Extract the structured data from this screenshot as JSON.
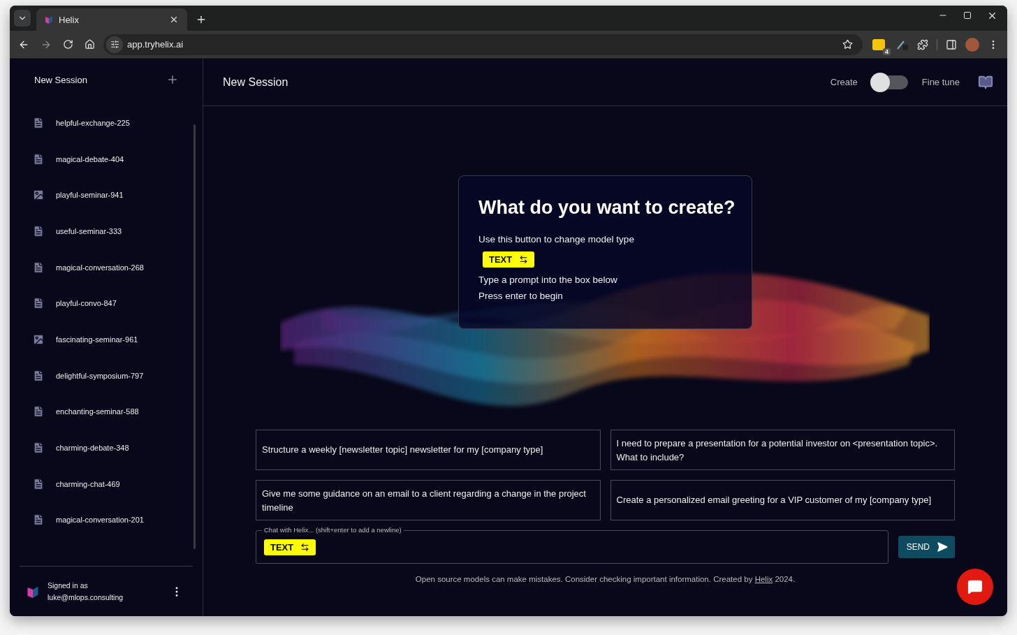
{
  "browser": {
    "tab_title": "Helix",
    "url": "app.tryhelix.ai",
    "extension_badge": "4"
  },
  "sidebar": {
    "title": "New Session",
    "sessions": [
      {
        "name": "helpful-exchange-225",
        "kind": "text"
      },
      {
        "name": "magical-debate-404",
        "kind": "text"
      },
      {
        "name": "playful-seminar-941",
        "kind": "image"
      },
      {
        "name": "useful-seminar-333",
        "kind": "text"
      },
      {
        "name": "magical-conversation-268",
        "kind": "text"
      },
      {
        "name": "playful-convo-847",
        "kind": "text"
      },
      {
        "name": "fascinating-seminar-961",
        "kind": "image"
      },
      {
        "name": "delightful-symposium-797",
        "kind": "text"
      },
      {
        "name": "enchanting-seminar-588",
        "kind": "text"
      },
      {
        "name": "charming-debate-348",
        "kind": "text"
      },
      {
        "name": "charming-chat-469",
        "kind": "text"
      },
      {
        "name": "magical-conversation-201",
        "kind": "text"
      }
    ],
    "user": {
      "label": "Signed in as",
      "email": "luke@mlops.consulting"
    }
  },
  "header": {
    "title": "New Session",
    "toggle": {
      "left_label": "Create",
      "right_label": "Fine tune",
      "on": false
    }
  },
  "intro": {
    "heading": "What do you want to create?",
    "steps": [
      {
        "kind": "text",
        "text": "Use this button to change model type"
      },
      {
        "kind": "button",
        "text": "TEXT"
      },
      {
        "kind": "text",
        "text": "Type a prompt into the box below"
      },
      {
        "kind": "text",
        "text": "Press enter to begin"
      }
    ]
  },
  "suggestions": [
    "Structure a weekly [newsletter topic] newsletter for my [company type]",
    "I need to prepare a presentation for a potential investor on <presentation topic>. What to include?",
    "Give me some guidance on an email to a client regarding a change in the project timeline",
    "Create a personalized email greeting for a VIP customer of my [company type]"
  ],
  "chat": {
    "label": "Chat with Helix... (shift+enter to add a newline)",
    "model_button": "TEXT",
    "send": "SEND"
  },
  "footer": {
    "text": "Open source models can make mistakes. Consider checking important information. Created by",
    "link": "Helix",
    "after": "2024."
  }
}
